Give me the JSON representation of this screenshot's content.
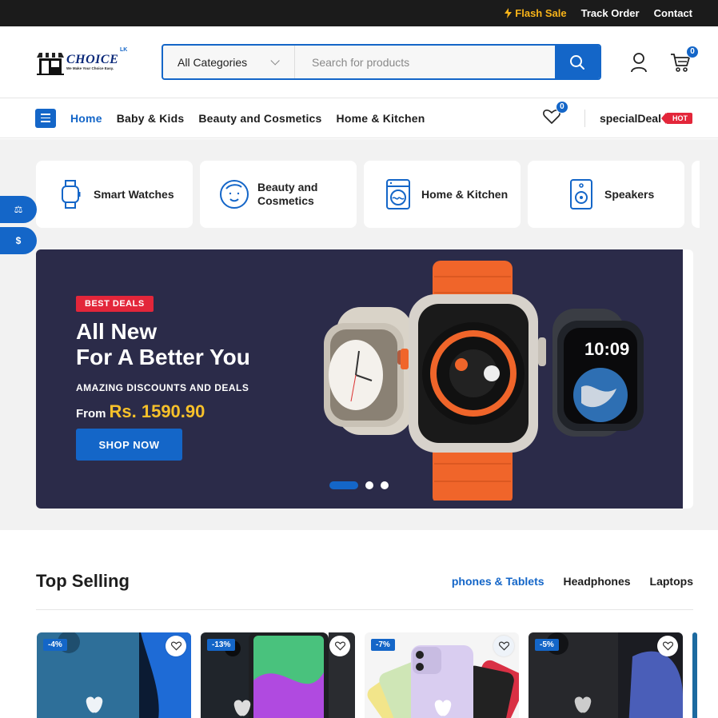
{
  "topbar": {
    "flash_sale": "Flash Sale",
    "track_order": "Track Order",
    "contact": "Contact"
  },
  "logo": {
    "name": "CHOICE",
    "tagline": "We Make Your Choice Easy.",
    "suffix": "LK"
  },
  "search": {
    "category": "All Categories",
    "placeholder": "Search for products"
  },
  "header": {
    "cart_count": "0"
  },
  "nav": {
    "links": [
      "Home",
      "Baby & Kids",
      "Beauty and Cosmetics",
      "Home & Kitchen"
    ],
    "wishlist_count": "0",
    "special_deal": "specialDeal",
    "hot": "HOT"
  },
  "categories": [
    {
      "label": "Smart Watches",
      "icon": "watch-icon"
    },
    {
      "label": "Beauty and Cosmetics",
      "icon": "face-icon"
    },
    {
      "label": "Home & Kitchen",
      "icon": "washing-machine-icon"
    },
    {
      "label": "Speakers",
      "icon": "speaker-icon"
    }
  ],
  "side_tabs": {
    "compare": "⚖",
    "currency": "$"
  },
  "banner": {
    "tag": "BEST DEALS",
    "heading_line1": "All New",
    "heading_line2": "For A Better You",
    "subtitle": "AMAZING DISCOUNTS AND DEALS",
    "price_prefix": "From",
    "price": "Rs. 1590.90",
    "button": "SHOP NOW",
    "watch_time": "10:09",
    "active_slide": 1,
    "slide_count": 3
  },
  "top_selling": {
    "title": "Top Selling",
    "tabs": [
      "phones & Tablets",
      "Headphones",
      "Laptops"
    ],
    "products": [
      {
        "discount": "-4%"
      },
      {
        "discount": "-13%"
      },
      {
        "discount": "-7%"
      },
      {
        "discount": "-5%"
      }
    ]
  },
  "colors": {
    "accent": "#1466c8",
    "flash": "#f7b319",
    "hot": "#e3263a",
    "banner_bg": "#2b2b49",
    "price": "#f7c12a"
  }
}
